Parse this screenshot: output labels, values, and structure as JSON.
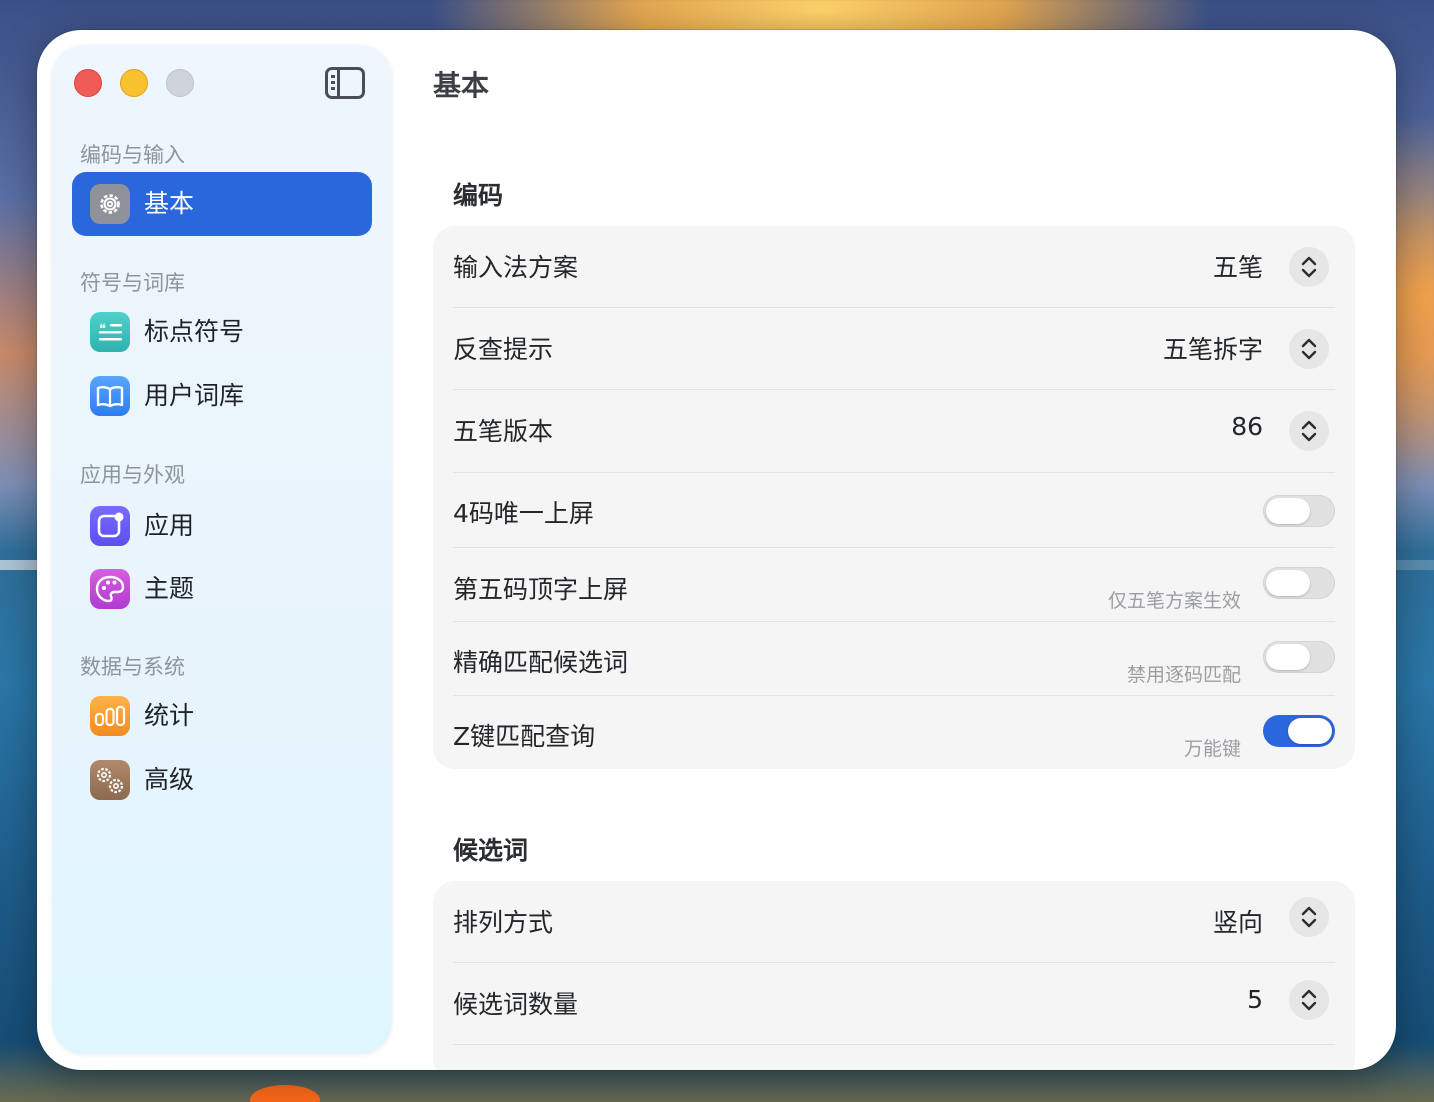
{
  "sidebar": {
    "sections": [
      {
        "label": "编码与输入",
        "items": [
          {
            "label": "基本",
            "icon": "gear-icon",
            "active": true
          }
        ]
      },
      {
        "label": "符号与词库",
        "items": [
          {
            "label": "标点符号",
            "icon": "quote-icon",
            "glyph": "❝"
          },
          {
            "label": "用户词库",
            "icon": "book-icon",
            "glyph": "📖"
          }
        ]
      },
      {
        "label": "应用与外观",
        "items": [
          {
            "label": "应用",
            "icon": "app-icon"
          },
          {
            "label": "主题",
            "icon": "palette-icon"
          }
        ]
      },
      {
        "label": "数据与系统",
        "items": [
          {
            "label": "统计",
            "icon": "chart-icon",
            "glyph": "000"
          },
          {
            "label": "高级",
            "icon": "gears-icon",
            "glyph": "⚙"
          }
        ]
      }
    ]
  },
  "page": {
    "title": "基本"
  },
  "groups": [
    {
      "title": "编码",
      "rows": [
        {
          "label": "输入法方案",
          "type": "select",
          "value": "五笔"
        },
        {
          "label": "反查提示",
          "type": "select",
          "value": "五笔拆字"
        },
        {
          "label": "五笔版本",
          "type": "select",
          "value": "86"
        },
        {
          "label": "4码唯一上屏",
          "type": "toggle",
          "on": false
        },
        {
          "label": "第五码顶字上屏",
          "type": "toggle",
          "on": false,
          "sub": "仅五笔方案生效"
        },
        {
          "label": "精确匹配候选词",
          "type": "toggle",
          "on": false,
          "sub": "禁用逐码匹配"
        },
        {
          "label": "Z键匹配查询",
          "type": "toggle",
          "on": true,
          "sub": "万能键"
        }
      ]
    },
    {
      "title": "候选词",
      "rows": [
        {
          "label": "排列方式",
          "type": "select",
          "value": "竖向"
        },
        {
          "label": "候选词数量",
          "type": "select",
          "value": "5"
        }
      ]
    }
  ],
  "colors": {
    "accent": "#2a66dc",
    "close": "#ef5b57",
    "minimize": "#f8c12f",
    "zoom": "#cfd4da"
  }
}
